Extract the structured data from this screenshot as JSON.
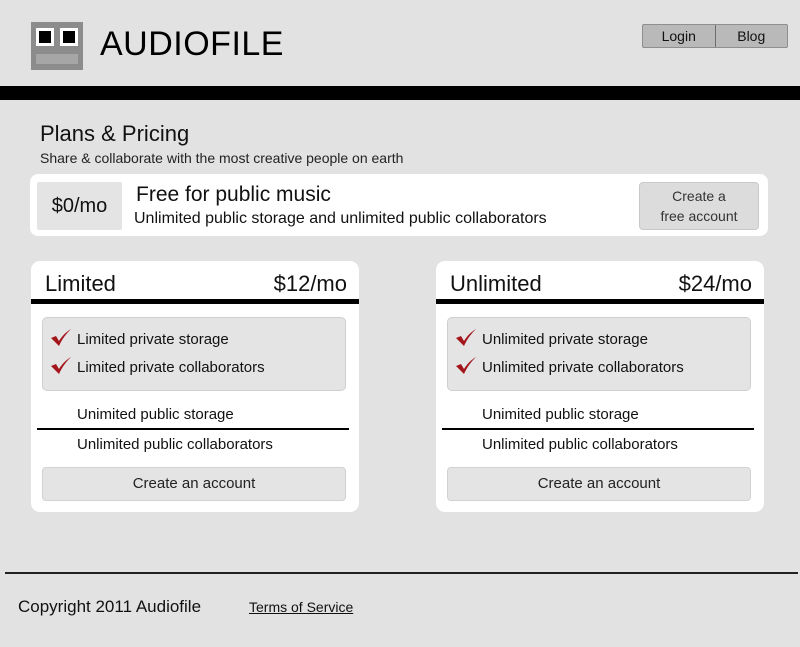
{
  "header": {
    "brand": "AUDIOFILE",
    "logo_icon": "speaker-logo-icon",
    "nav": [
      {
        "label": "Login"
      },
      {
        "label": "Blog"
      }
    ]
  },
  "heading": {
    "title": "Plans & Pricing",
    "subtitle": "Share & collaborate with the most creative people on earth"
  },
  "free_plan": {
    "price": "$0/mo",
    "title": "Free for public music",
    "description": "Unlimited public storage and unlimited public collaborators",
    "cta_line1": "Create a",
    "cta_line2": "free account"
  },
  "plans": [
    {
      "name": "Limited",
      "price": "$12/mo",
      "highlighted_features": [
        "Limited private storage",
        "Limited private collaborators"
      ],
      "features": [
        "Unimited public storage",
        "Unlimited public collaborators"
      ],
      "cta": "Create an account"
    },
    {
      "name": "Unlimited",
      "price": "$24/mo",
      "highlighted_features": [
        "Unlimited private storage",
        "Unlimited private collaborators"
      ],
      "features": [
        "Unimited public storage",
        "Unlimited public collaborators"
      ],
      "cta": "Create an account"
    }
  ],
  "footer": {
    "copyright": "Copyright 2011 Audiofile",
    "terms_link": "Terms of Service"
  },
  "colors": {
    "background": "#e2e2e2",
    "card": "#ffffff",
    "accent_check": "#a3151b",
    "bar": "#000000",
    "button": "#e4e4e4"
  }
}
